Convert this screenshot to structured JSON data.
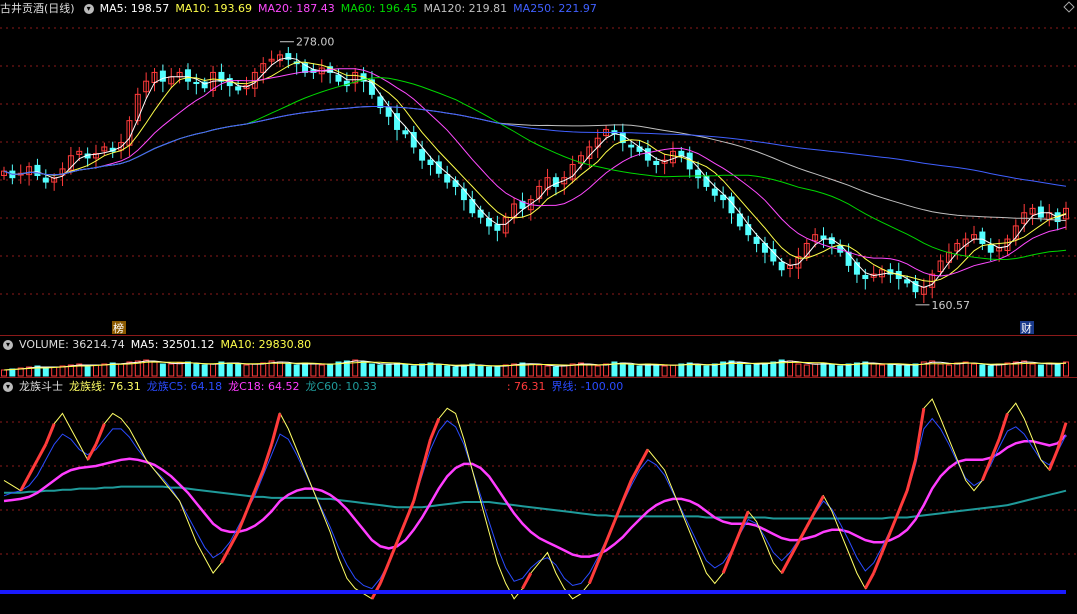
{
  "colors": {
    "up": "#ff3b3b",
    "down": "#54ffff",
    "ma5": "#ffffff",
    "ma10": "#ffff4a",
    "ma20": "#ff4aff",
    "ma60": "#00d800",
    "ma120": "#c0c0c0",
    "ma250": "#4060ff",
    "grid": "#8b1a1a",
    "dragon_line": "#ffff66",
    "dragon_c5": "#2a4bff",
    "dragon_c18": "#ff3dff",
    "dragon_c60": "#1f9a9a",
    "boundary": "#1a1aff"
  },
  "price_legend": {
    "stock_name": "古井贡酒(日线)",
    "ma5": "MA5: 198.57",
    "ma10": "MA10: 193.69",
    "ma20": "MA20: 187.43",
    "ma60": "MA60: 196.45",
    "ma120": "MA120: 219.81",
    "ma250": "MA250: 221.97"
  },
  "price_annotations": {
    "high_label": "278.00",
    "low_label": "160.57",
    "badge_rank": "榜",
    "badge_finance": "财"
  },
  "volume_legend": {
    "volume": "VOLUME: 36214.74",
    "ma5": "MA5: 32501.12",
    "ma10": "MA10: 29830.80"
  },
  "indicator_legend": {
    "name": "龙族斗士",
    "dragon_line": "龙族线: 76.31",
    "c5": "龙族C5: 64.18",
    "c18": "龙C18: 64.52",
    "c60": "龙C60: 10.33",
    "extra": ": 76.31",
    "boundary": "界线: -100.00"
  },
  "chart_data": {
    "type": "candlestick",
    "price_range": [
      160.57,
      278.0
    ],
    "high_marker": 278.0,
    "low_marker": 160.57,
    "latest": {
      "ma5": 198.57,
      "ma10": 193.69,
      "ma20": 187.43,
      "ma60": 196.45,
      "ma120": 219.81,
      "ma250": 221.97,
      "volume": 36214.74,
      "vol_ma5": 32501.12,
      "vol_ma10": 29830.8,
      "dragon_line": 76.31,
      "dragon_c5": 64.18,
      "dragon_c18": 64.52,
      "dragon_c60": 10.33,
      "boundary": -100.0
    },
    "close_path": [
      217,
      214,
      216,
      219,
      215,
      212,
      214,
      218,
      224,
      226,
      223,
      225,
      228,
      226,
      230,
      240,
      252,
      258,
      262,
      258,
      260,
      262,
      258,
      257,
      255,
      262,
      258,
      256,
      254,
      256,
      262,
      266,
      268,
      270,
      268,
      266,
      262,
      262,
      264,
      262,
      258,
      256,
      262,
      258,
      252,
      246,
      242,
      236,
      234,
      228,
      222,
      220,
      216,
      212,
      210,
      204,
      198,
      196,
      192,
      190,
      196,
      202,
      200,
      204,
      210,
      214,
      210,
      214,
      220,
      224,
      228,
      232,
      236,
      234,
      230,
      228,
      226,
      222,
      220,
      222,
      226,
      224,
      218,
      214,
      210,
      206,
      204,
      198,
      192,
      188,
      184,
      180,
      176,
      172,
      174,
      178,
      184,
      188,
      186,
      184,
      180,
      174,
      170,
      168,
      170,
      172,
      170,
      168,
      166,
      162,
      164,
      170,
      176,
      180,
      184,
      186,
      188,
      184,
      180,
      182,
      186,
      192,
      198,
      200,
      196,
      198,
      194,
      200
    ],
    "volume_path": [
      0.3,
      0.35,
      0.4,
      0.45,
      0.5,
      0.4,
      0.45,
      0.5,
      0.55,
      0.6,
      0.5,
      0.55,
      0.6,
      0.65,
      0.6,
      0.7,
      0.75,
      0.8,
      0.7,
      0.6,
      0.6,
      0.65,
      0.7,
      0.6,
      0.55,
      0.6,
      0.7,
      0.65,
      0.6,
      0.55,
      0.6,
      0.65,
      0.75,
      0.7,
      0.6,
      0.55,
      0.65,
      0.6,
      0.55,
      0.6,
      0.7,
      0.75,
      0.8,
      0.7,
      0.6,
      0.55,
      0.6,
      0.65,
      0.55,
      0.5,
      0.6,
      0.65,
      0.55,
      0.5,
      0.45,
      0.55,
      0.6,
      0.5,
      0.45,
      0.5,
      0.55,
      0.6,
      0.65,
      0.6,
      0.55,
      0.5,
      0.45,
      0.55,
      0.6,
      0.65,
      0.55,
      0.5,
      0.6,
      0.7,
      0.65,
      0.55,
      0.5,
      0.6,
      0.55,
      0.5,
      0.55,
      0.6,
      0.65,
      0.55,
      0.5,
      0.6,
      0.7,
      0.75,
      0.65,
      0.55,
      0.6,
      0.65,
      0.7,
      0.8,
      0.75,
      0.6,
      0.55,
      0.6,
      0.65,
      0.55,
      0.5,
      0.6,
      0.65,
      0.7,
      0.6,
      0.55,
      0.6,
      0.55,
      0.5,
      0.6,
      0.7,
      0.75,
      0.6,
      0.55,
      0.65,
      0.7,
      0.6,
      0.55,
      0.5,
      0.6,
      0.65,
      0.7,
      0.75,
      0.6,
      0.55,
      0.65,
      0.6,
      0.7
    ],
    "dragon_line_path": [
      20,
      15,
      10,
      25,
      40,
      55,
      75,
      85,
      70,
      55,
      40,
      55,
      75,
      85,
      80,
      70,
      55,
      40,
      30,
      20,
      10,
      0,
      -20,
      -40,
      -55,
      -70,
      -60,
      -45,
      -30,
      -10,
      10,
      30,
      55,
      85,
      70,
      50,
      30,
      10,
      -10,
      -30,
      -55,
      -75,
      -85,
      -90,
      -95,
      -80,
      -60,
      -40,
      -20,
      0,
      30,
      60,
      80,
      90,
      85,
      60,
      30,
      0,
      -30,
      -60,
      -80,
      -95,
      -85,
      -70,
      -60,
      -50,
      -70,
      -85,
      -95,
      -90,
      -80,
      -60,
      -40,
      -20,
      0,
      20,
      35,
      50,
      40,
      30,
      10,
      -10,
      -30,
      -50,
      -70,
      -80,
      -70,
      -50,
      -30,
      -10,
      -20,
      -40,
      -60,
      -70,
      -55,
      -40,
      -25,
      -10,
      5,
      -10,
      -30,
      -50,
      -70,
      -85,
      -70,
      -50,
      -30,
      -10,
      10,
      40,
      90,
      99,
      80,
      60,
      40,
      20,
      10,
      20,
      40,
      60,
      85,
      95,
      80,
      60,
      40,
      30,
      50,
      76
    ],
    "c5_path": [
      5,
      8,
      10,
      15,
      25,
      40,
      55,
      65,
      60,
      50,
      45,
      50,
      60,
      70,
      70,
      62,
      50,
      40,
      30,
      22,
      12,
      0,
      -15,
      -30,
      -45,
      -55,
      -50,
      -40,
      -25,
      -10,
      5,
      25,
      45,
      65,
      60,
      45,
      28,
      10,
      -8,
      -25,
      -45,
      -62,
      -75,
      -82,
      -85,
      -75,
      -60,
      -42,
      -22,
      0,
      25,
      50,
      68,
      78,
      72,
      55,
      30,
      5,
      -20,
      -45,
      -65,
      -78,
      -75,
      -65,
      -58,
      -55,
      -62,
      -75,
      -82,
      -80,
      -70,
      -55,
      -38,
      -20,
      -2,
      15,
      30,
      40,
      35,
      25,
      8,
      -8,
      -25,
      -42,
      -58,
      -65,
      -60,
      -48,
      -32,
      -18,
      -22,
      -35,
      -50,
      -58,
      -50,
      -38,
      -25,
      -12,
      0,
      -8,
      -22,
      -38,
      -55,
      -68,
      -60,
      -45,
      -28,
      -10,
      8,
      35,
      70,
      80,
      70,
      55,
      38,
      22,
      15,
      20,
      35,
      52,
      68,
      72,
      65,
      52,
      40,
      35,
      48,
      64
    ],
    "c18_path": [
      0,
      1,
      2,
      4,
      8,
      14,
      20,
      26,
      30,
      32,
      33,
      34,
      36,
      38,
      40,
      41,
      40,
      38,
      35,
      30,
      24,
      16,
      8,
      -2,
      -12,
      -22,
      -28,
      -30,
      -30,
      -28,
      -24,
      -18,
      -10,
      0,
      6,
      10,
      12,
      12,
      10,
      6,
      0,
      -8,
      -18,
      -28,
      -38,
      -44,
      -46,
      -44,
      -38,
      -28,
      -16,
      -2,
      12,
      24,
      32,
      36,
      36,
      32,
      24,
      12,
      0,
      -12,
      -22,
      -30,
      -36,
      -40,
      -44,
      -48,
      -52,
      -54,
      -54,
      -52,
      -48,
      -42,
      -35,
      -26,
      -18,
      -10,
      -4,
      0,
      2,
      2,
      0,
      -4,
      -10,
      -16,
      -20,
      -22,
      -22,
      -22,
      -24,
      -28,
      -32,
      -36,
      -38,
      -38,
      -36,
      -34,
      -30,
      -28,
      -28,
      -30,
      -34,
      -38,
      -40,
      -40,
      -38,
      -34,
      -28,
      -18,
      -4,
      12,
      24,
      32,
      38,
      40,
      40,
      40,
      42,
      46,
      52,
      56,
      58,
      58,
      56,
      54,
      56,
      64
    ],
    "c60_path": [
      8,
      8,
      8,
      9,
      9,
      10,
      10,
      11,
      11,
      12,
      12,
      12,
      13,
      13,
      14,
      14,
      14,
      14,
      14,
      14,
      13,
      13,
      12,
      11,
      10,
      9,
      8,
      7,
      6,
      5,
      4,
      4,
      3,
      3,
      3,
      3,
      3,
      3,
      2,
      2,
      1,
      0,
      -1,
      -2,
      -3,
      -4,
      -5,
      -6,
      -6,
      -6,
      -6,
      -5,
      -4,
      -3,
      -2,
      -1,
      -1,
      -1,
      -1,
      -2,
      -3,
      -4,
      -5,
      -6,
      -7,
      -8,
      -9,
      -10,
      -11,
      -12,
      -13,
      -14,
      -14,
      -15,
      -15,
      -15,
      -15,
      -15,
      -15,
      -15,
      -15,
      -15,
      -15,
      -15,
      -16,
      -16,
      -16,
      -16,
      -16,
      -16,
      -16,
      -16,
      -17,
      -17,
      -17,
      -17,
      -17,
      -17,
      -17,
      -17,
      -17,
      -17,
      -17,
      -17,
      -17,
      -17,
      -16,
      -16,
      -16,
      -15,
      -14,
      -13,
      -12,
      -11,
      -10,
      -9,
      -8,
      -7,
      -6,
      -5,
      -4,
      -2,
      0,
      2,
      4,
      6,
      8,
      10
    ]
  }
}
